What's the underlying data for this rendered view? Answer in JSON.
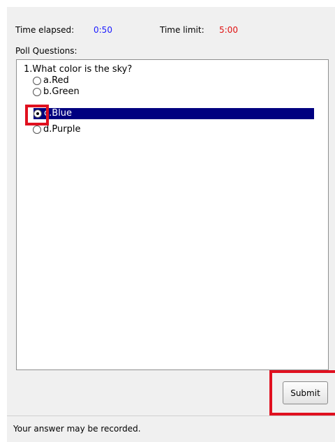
{
  "timer": {
    "elapsed_label": "Time elapsed:",
    "elapsed_value": "0:50",
    "limit_label": "Time limit:",
    "limit_value": "5:00"
  },
  "poll": {
    "section_label": "Poll Questions:",
    "question": "1.What color is the sky?",
    "options": [
      {
        "label": "a.Red",
        "selected": false
      },
      {
        "label": "b.Green",
        "selected": false
      },
      {
        "label": "c.Blue",
        "selected": true
      },
      {
        "label": "d.Purple",
        "selected": false
      }
    ]
  },
  "actions": {
    "submit_label": "Submit"
  },
  "status": {
    "text": "Your answer may be recorded."
  },
  "colors": {
    "elapsed_value": "#1a1aff",
    "limit_value": "#e01010",
    "selection_bg": "#000080",
    "annotation_red": "#e0101f"
  },
  "icons": {
    "radio_unchecked": "radio-unchecked-icon",
    "radio_checked": "radio-checked-icon"
  }
}
